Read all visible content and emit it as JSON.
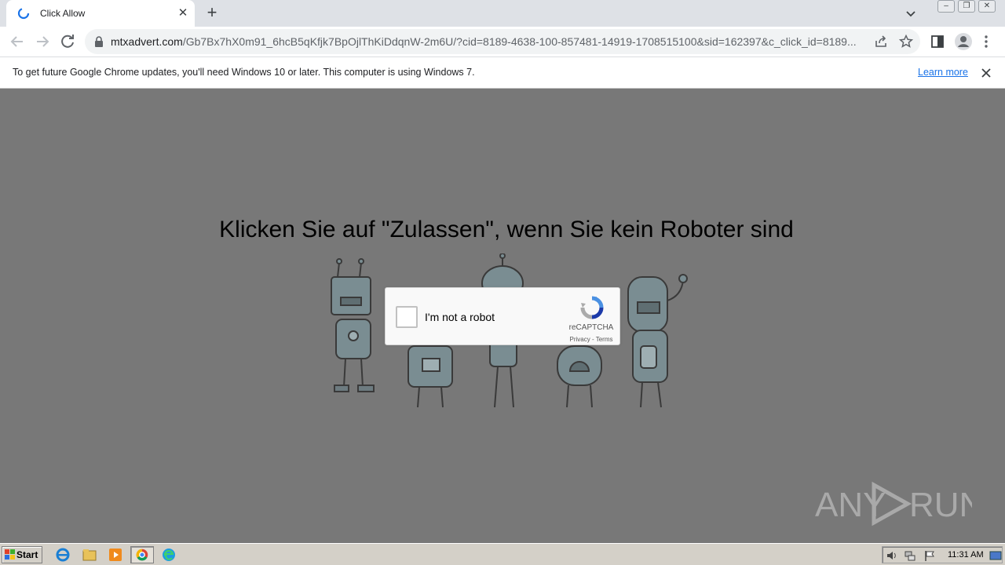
{
  "browser": {
    "tab": {
      "title": "Click Allow"
    },
    "url": {
      "host": "mtxadvert.com",
      "path": "/Gb7Bx7hX0m91_6hcB5qKfjk7BpOjlThKiDdqnW-2m6U/?cid=8189-4638-100-857481-14919-1708515100&sid=162397&c_click_id=8189..."
    },
    "infobar": {
      "message": "To get future Google Chrome updates, you'll need Windows 10 or later. This computer is using Windows 7.",
      "link": "Learn more"
    }
  },
  "page": {
    "headline": "Klicken Sie auf \"Zulassen\", wenn Sie kein Roboter sind",
    "recaptcha": {
      "label": "I'm not a robot",
      "brand": "reCAPTCHA",
      "terms": "Privacy - Terms"
    },
    "watermark": "ANY RUN"
  },
  "taskbar": {
    "start": "Start",
    "clock": "11:31 AM"
  },
  "colors": {
    "page_overlay": "#787878",
    "link": "#1a73e8",
    "robot_body": "#8fb1bd"
  }
}
